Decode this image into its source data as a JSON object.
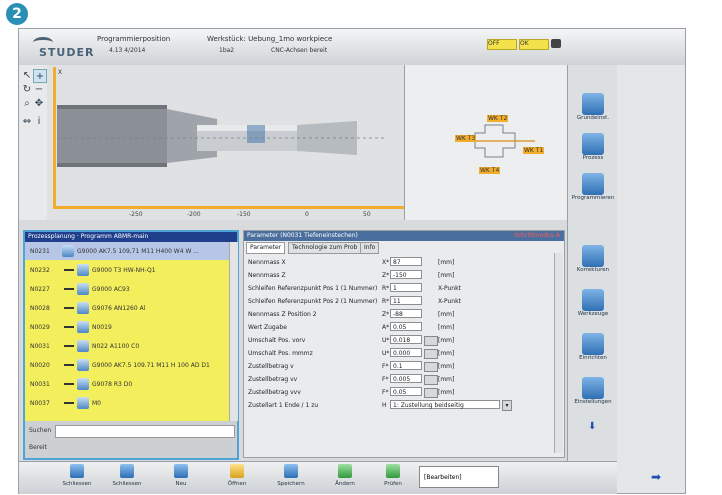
{
  "step_badge": "2",
  "header": {
    "logo": "STUDER",
    "program_label": "Programmierposition",
    "program_sub": "4.13 4/2014",
    "workpiece_label": "Werkstück: Uebung_1mo workpiece",
    "workpiece_sub": "1ba2",
    "mode_label": "CNC-Achsen bereit",
    "status_badges": [
      "OFF",
      "OK"
    ]
  },
  "viewport": {
    "tools": [
      "cursor",
      "zoom-plus",
      "rotate",
      "zoom-minus",
      "magnifier",
      "pan",
      "measure",
      "info"
    ],
    "axis_label_y": "X",
    "ticks": [
      "-250",
      "-200",
      "-150",
      "0",
      "50"
    ]
  },
  "preview": {
    "labels": [
      "WK T2",
      "WK T3",
      "WK T1",
      "WK T4"
    ]
  },
  "side_nav": [
    {
      "label": "Grundeinst.",
      "icon": "grinding-icon"
    },
    {
      "label": "Prozess",
      "icon": "process-icon"
    },
    {
      "label": "Programmieren",
      "icon": "program-icon"
    },
    {
      "label": "Korrekturen",
      "icon": "correction-icon"
    },
    {
      "label": "Werkzeuge",
      "icon": "tools-icon"
    },
    {
      "label": "Einrichten",
      "icon": "setup-icon"
    },
    {
      "label": "Einstellungen",
      "icon": "settings-icon"
    }
  ],
  "list_panel": {
    "title": "Prozessplanung · Programm ABMR-main",
    "rows": [
      {
        "nr": "N0231",
        "text": "G9000 AK7.5 109,71 M11 H400 W4 W ...",
        "icon": "block",
        "selected": true
      },
      {
        "nr": "N0232",
        "text": "G9000 T3 HW-NH-Q1",
        "icon": "gap",
        "selected": false
      },
      {
        "nr": "N0227",
        "text": "G9000 AC93",
        "icon": "block",
        "selected": false
      },
      {
        "nr": "N0028",
        "text": "G9076 AN1260 Al",
        "icon": "block",
        "selected": false
      },
      {
        "nr": "N0029",
        "text": "N0019",
        "icon": "grid",
        "selected": false
      },
      {
        "nr": "N0031",
        "text": "N022 A1100 C0",
        "icon": "gap",
        "selected": false
      },
      {
        "nr": "N0020",
        "text": "G9000 AK7.5 109.71 M11 H 100 AD D1",
        "icon": "block",
        "selected": false
      },
      {
        "nr": "N0031",
        "text": "G9078 R3 D0",
        "icon": "block",
        "selected": false
      },
      {
        "nr": "N0037",
        "text": "M0",
        "icon": "grid",
        "selected": false
      }
    ],
    "search_label": "Suchen",
    "footer_label": "Bereit"
  },
  "param_panel": {
    "title": "Parameter (N0031 Tiefeneinstechen)",
    "error": "Schrittmodus A",
    "tabs": [
      "Parameter",
      "Technologie zum Prob",
      "Info"
    ],
    "rows": [
      {
        "label": "Nennmass X",
        "sym": "X*",
        "value": "87",
        "unit": "[mm]",
        "has_btn": false
      },
      {
        "label": "Nennmass Z",
        "sym": "Z*",
        "value": "-150",
        "unit": "[mm]",
        "has_btn": false
      },
      {
        "label": "Schleifen Referenzpunkt Pos 1 (1 Nummer)",
        "sym": "R*",
        "value": "1",
        "unit": "X-Punkt",
        "has_btn": false
      },
      {
        "label": "Schleifen Referenzpunkt Pos 2 (1 Nummer)",
        "sym": "R*",
        "value": "11",
        "unit": "X-Punkt",
        "has_btn": false
      },
      {
        "label": "Nennmass Z Position 2",
        "sym": "Z*",
        "value": "-88",
        "unit": "[mm]",
        "has_btn": false
      },
      {
        "label": "Wert Zugabe",
        "sym": "A*",
        "value": "0.05",
        "unit": "[mm]",
        "has_btn": false
      },
      {
        "label": "Umschalt Pos. vorv",
        "sym": "U*",
        "value": "0.018",
        "unit": "[mm]",
        "has_btn": true
      },
      {
        "label": "Umschalt Pos. mmmz",
        "sym": "U*",
        "value": "0.000",
        "unit": "[mm]",
        "has_btn": true
      },
      {
        "label": "Zustellbetrag v",
        "sym": "F*",
        "value": "0.1",
        "unit": "[mm]",
        "has_btn": true
      },
      {
        "label": "Zustellbetrag vv",
        "sym": "F*",
        "value": "0.005",
        "unit": "[mm]",
        "has_btn": true
      },
      {
        "label": "Zustellbetrag vvv",
        "sym": "F*",
        "value": "0.05",
        "unit": "[mm]",
        "has_btn": true
      },
      {
        "label": "Zustellart 1 Ende / 1 zu",
        "sym": "H",
        "value": "1: Zustellung beidseitig",
        "unit": "",
        "has_btn": false
      }
    ]
  },
  "bottom_bar": {
    "buttons": [
      "Schliessen",
      "Schliessen",
      "Neu",
      "Öffnen",
      "Speichern",
      "Ändern",
      "Prüfen"
    ],
    "status": "[Bearbeiten]"
  }
}
